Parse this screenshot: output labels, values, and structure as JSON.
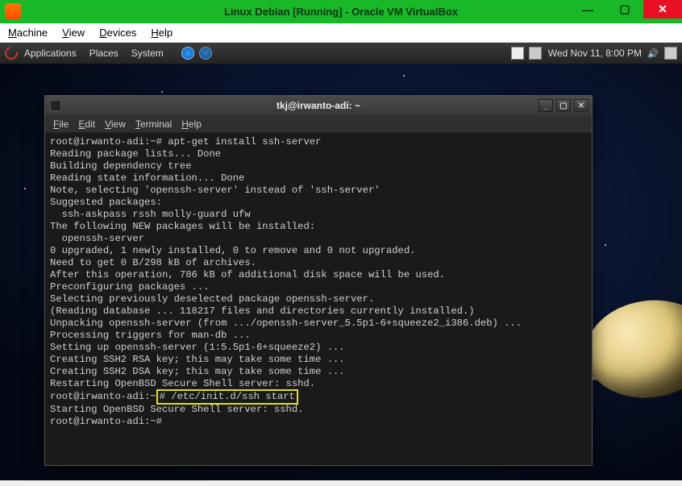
{
  "vb": {
    "title": "Linux Debian [Running] - Oracle VM VirtualBox",
    "menu": {
      "machine": "Machine",
      "view": "View",
      "devices": "Devices",
      "help": "Help"
    }
  },
  "gnome": {
    "menu": {
      "applications": "Applications",
      "places": "Places",
      "system": "System"
    },
    "clock": "Wed Nov 11,  8:00 PM"
  },
  "desk": {
    "icon1": "C",
    "icon2": "tk"
  },
  "term": {
    "title": "tkj@irwanto-adi: ~",
    "menu": {
      "file": "File",
      "edit": "Edit",
      "view": "View",
      "terminal": "Terminal",
      "help": "Help"
    },
    "lines": {
      "l00": "root@irwanto-adi:~# apt-get install ssh-server",
      "l01": "Reading package lists... Done",
      "l02": "Building dependency tree",
      "l03": "Reading state information... Done",
      "l04": "Note, selecting 'openssh-server' instead of 'ssh-server'",
      "l05": "Suggested packages:",
      "l06": "  ssh-askpass rssh molly-guard ufw",
      "l07": "The following NEW packages will be installed:",
      "l08": "  openssh-server",
      "l09": "0 upgraded, 1 newly installed, 0 to remove and 0 not upgraded.",
      "l10": "Need to get 0 B/298 kB of archives.",
      "l11": "After this operation, 786 kB of additional disk space will be used.",
      "l12": "Preconfiguring packages ...",
      "l13": "Selecting previously deselected package openssh-server.",
      "l14": "(Reading database ... 118217 files and directories currently installed.)",
      "l15": "Unpacking openssh-server (from .../openssh-server_5.5p1-6+squeeze2_i386.deb) ...",
      "l16": "Processing triggers for man-db ...",
      "l17": "Setting up openssh-server (1:5.5p1-6+squeeze2) ...",
      "l18": "Creating SSH2 RSA key; this may take some time ...",
      "l19": "Creating SSH2 DSA key; this may take some time ...",
      "l20": "Restarting OpenBSD Secure Shell server: sshd.",
      "l21_prompt": "root@irwanto-adi:~",
      "l21_cmd": "# /etc/init.d/ssh start",
      "l22": "Starting OpenBSD Secure Shell server: sshd.",
      "l23": "root@irwanto-adi:~#"
    }
  }
}
